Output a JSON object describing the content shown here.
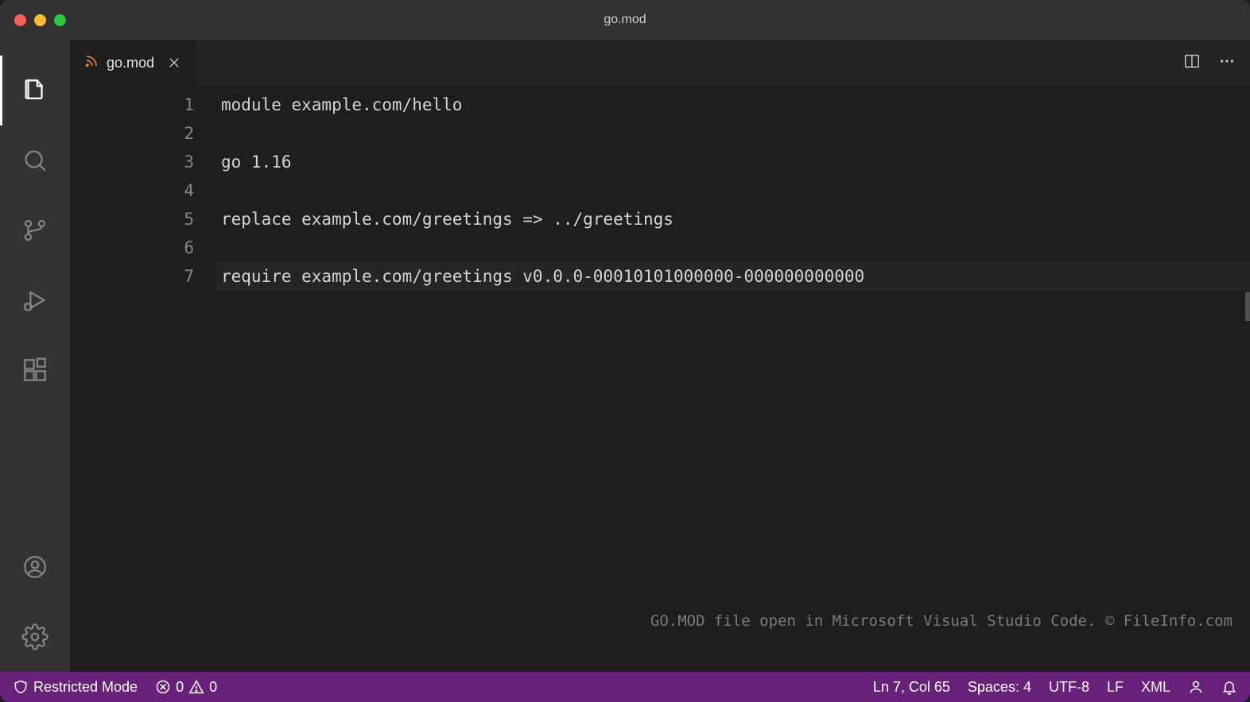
{
  "window": {
    "title": "go.mod"
  },
  "tab": {
    "filename": "go.mod",
    "file_icon": "rss-icon"
  },
  "editor": {
    "lines": [
      "module example.com/hello",
      "",
      "go 1.16",
      "",
      "replace example.com/greetings => ../greetings",
      "",
      "require example.com/greetings v0.0.0-00010101000000-000000000000"
    ],
    "current_line": 7
  },
  "watermark": "GO.MOD file open in Microsoft Visual Studio Code. © FileInfo.com",
  "statusbar": {
    "restricted": "Restricted Mode",
    "errors": "0",
    "warnings": "0",
    "cursor": "Ln 7, Col 65",
    "spaces": "Spaces: 4",
    "encoding": "UTF-8",
    "eol": "LF",
    "language": "XML"
  },
  "activitybar": {
    "items": [
      "explorer",
      "search",
      "source-control",
      "run-debug",
      "extensions"
    ],
    "bottom": [
      "accounts",
      "settings"
    ]
  }
}
